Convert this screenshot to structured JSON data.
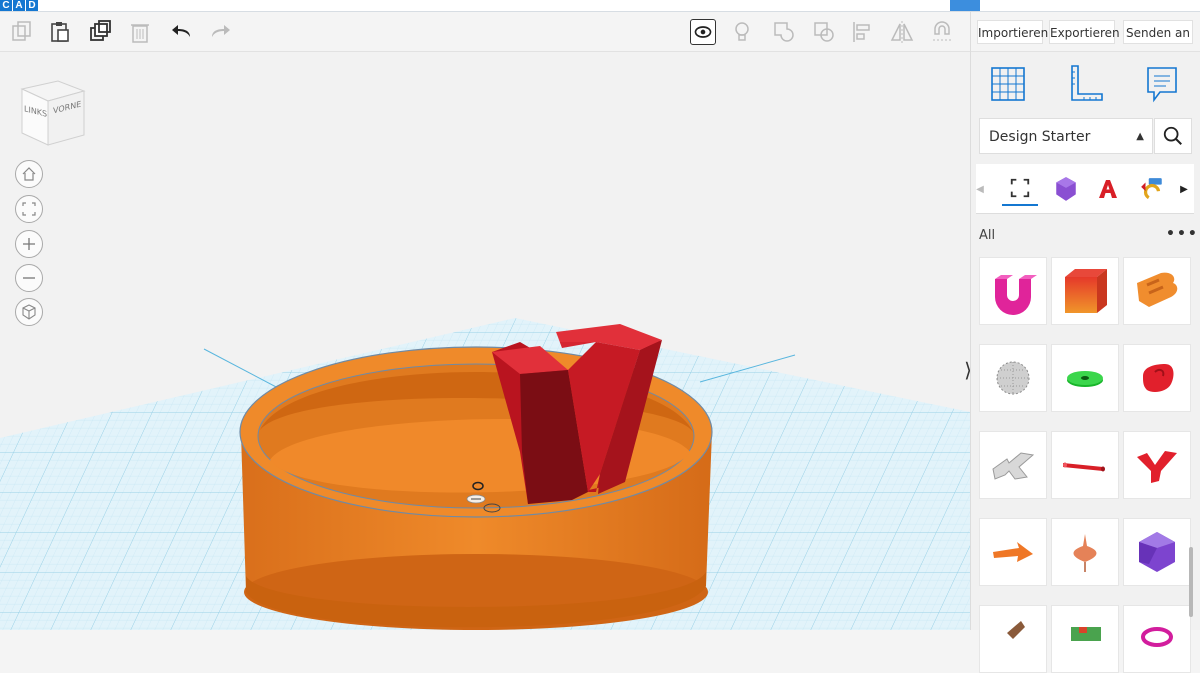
{
  "app": {
    "logo_letters": [
      "C",
      "A",
      "D"
    ]
  },
  "toolbar": {
    "copy_icon": "copy-icon",
    "paste_icon": "paste-icon",
    "duplicate_icon": "duplicate-icon",
    "delete_icon": "trash-icon",
    "undo_icon": "undo-icon",
    "redo_icon": "redo-icon",
    "show_all_icon": "eye-icon",
    "notes_icon": "lightbulb-icon",
    "group_icon": "group-icon",
    "ungroup_icon": "ungroup-icon",
    "align_icon": "align-icon",
    "mirror_icon": "mirror-icon",
    "workplane_icon": "magnet-icon"
  },
  "actions": {
    "import_label": "Importieren",
    "export_label": "Exportieren",
    "send_label": "Senden an"
  },
  "viewcube": {
    "left_label": "LINKS",
    "front_label": "VORNE"
  },
  "panel": {
    "library_selected": "Design Starter",
    "section_label": "All",
    "more_label": "•••",
    "collapse_label": "⟩"
  },
  "colors": {
    "accent": "#1477d1",
    "dish_orange": "#ef8a2a",
    "letter_red": "#c61a24",
    "grid_blue": "#a9d8ec"
  }
}
